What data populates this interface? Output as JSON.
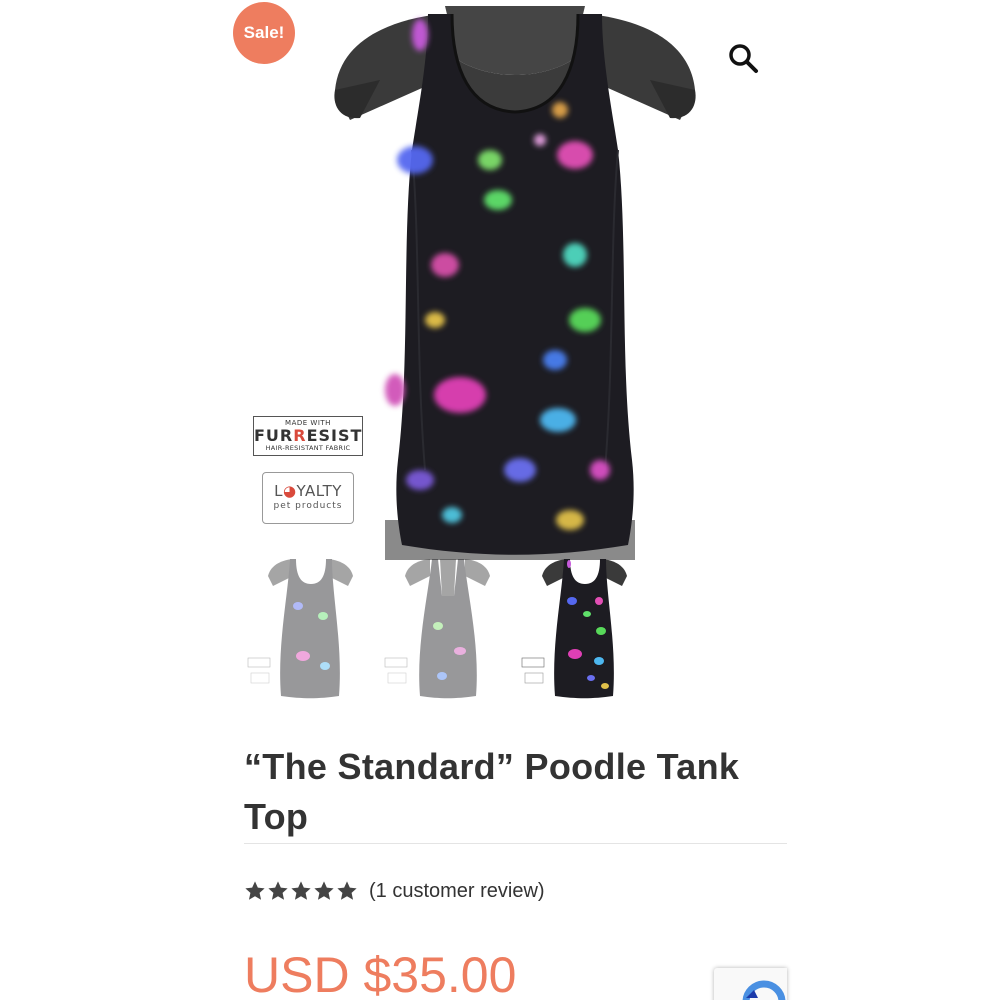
{
  "badge": {
    "label": "Sale!"
  },
  "icons": {
    "zoom": "magnifier-icon",
    "star": "star-icon",
    "captcha": "recaptcha-icon"
  },
  "image_badges": {
    "fabric": {
      "line1": "MADE WITH",
      "brand_a": "FUR",
      "brand_accent": "R",
      "brand_b": "ESIST",
      "line3": "HAIR-RESISTANT FABRIC"
    },
    "loyalty": {
      "brand_a": "L",
      "brand_b": "YALTY",
      "tagline": "pet products"
    }
  },
  "thumbnails": [
    {
      "name": "front-view",
      "active": false
    },
    {
      "name": "back-view",
      "active": false
    },
    {
      "name": "front-color-view",
      "active": true
    }
  ],
  "product": {
    "title": "“The Standard” Poodle Tank Top",
    "rating": 5,
    "rating_max": 5,
    "review_text": "(1 customer review)",
    "price": "USD $35.00"
  },
  "colors": {
    "accent": "#ee7d5f",
    "text": "#333333",
    "star": "#444444",
    "shirt": "#1d1c22",
    "mannequin": "#3c3c3c"
  }
}
